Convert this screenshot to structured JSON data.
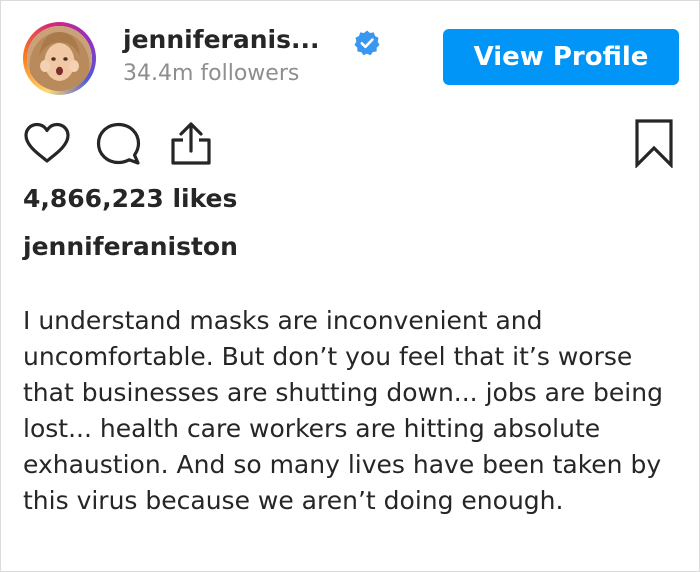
{
  "post": {
    "username_truncated": "jenniferanis...",
    "followers": "34.4m followers",
    "view_profile_label": "View Profile",
    "likes": "4,866,223 likes",
    "caption_username": "jenniferaniston",
    "caption_text": "I understand masks are inconvenient and uncomfortable. But don’t you feel that it’s worse that businesses are shutting down... jobs are being lost... health care workers are hitting absolute exhaustion. And so many lives have been taken by this virus because we aren’t doing enough."
  },
  "icons": {
    "avatar": "profile-photo",
    "verified": "verified-badge-icon",
    "like": "heart-icon",
    "comment": "comment-bubble-icon",
    "share": "share-icon",
    "save": "bookmark-icon"
  },
  "colors": {
    "button": "#0095f6",
    "verified": "#3897f0",
    "text": "#262626",
    "muted": "#8e8e8e"
  }
}
